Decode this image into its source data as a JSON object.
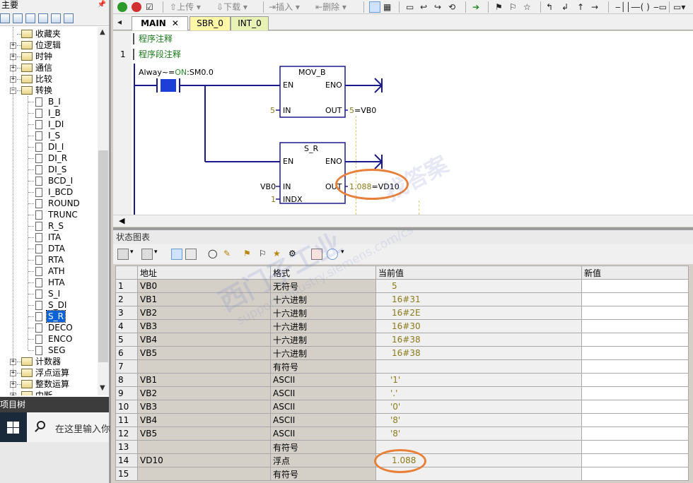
{
  "left_panel": {
    "title": "主要",
    "pin_icon": "pin-icon",
    "tree": [
      {
        "label": "收藏夹",
        "expander": "",
        "level": 1
      },
      {
        "label": "位逻辑",
        "expander": "+",
        "level": 1
      },
      {
        "label": "时钟",
        "expander": "+",
        "level": 1
      },
      {
        "label": "通信",
        "expander": "+",
        "level": 1
      },
      {
        "label": "比较",
        "expander": "+",
        "level": 1
      },
      {
        "label": "转换",
        "expander": "-",
        "level": 1
      },
      {
        "label": "B_I",
        "level": 2
      },
      {
        "label": "I_B",
        "level": 2
      },
      {
        "label": "I_DI",
        "level": 2
      },
      {
        "label": "I_S",
        "level": 2
      },
      {
        "label": "DI_I",
        "level": 2
      },
      {
        "label": "DI_R",
        "level": 2
      },
      {
        "label": "DI_S",
        "level": 2
      },
      {
        "label": "BCD_I",
        "level": 2
      },
      {
        "label": "I_BCD",
        "level": 2
      },
      {
        "label": "ROUND",
        "level": 2
      },
      {
        "label": "TRUNC",
        "level": 2
      },
      {
        "label": "R_S",
        "level": 2
      },
      {
        "label": "ITA",
        "level": 2
      },
      {
        "label": "DTA",
        "level": 2
      },
      {
        "label": "RTA",
        "level": 2
      },
      {
        "label": "ATH",
        "level": 2
      },
      {
        "label": "HTA",
        "level": 2
      },
      {
        "label": "S_I",
        "level": 2
      },
      {
        "label": "S_DI",
        "level": 2
      },
      {
        "label": "S_R",
        "level": 2,
        "selected": true
      },
      {
        "label": "DECO",
        "level": 2
      },
      {
        "label": "ENCO",
        "level": 2
      },
      {
        "label": "SEG",
        "level": 2
      },
      {
        "label": "计数器",
        "expander": "+",
        "level": 1
      },
      {
        "label": "浮点运算",
        "expander": "+",
        "level": 1
      },
      {
        "label": "整数运算",
        "expander": "+",
        "level": 1
      },
      {
        "label": "中断",
        "expander": "+",
        "level": 1
      }
    ],
    "project_tree_label": "项目树",
    "search_placeholder": "在这里输入你"
  },
  "toolbar": {
    "upload": "上传",
    "download": "下载",
    "insert": "插入",
    "delete": "删除"
  },
  "tabs": [
    {
      "label": "MAIN",
      "closable": true,
      "color": "#ffffff"
    },
    {
      "label": "SBR_0",
      "color": "#fff7a8"
    },
    {
      "label": "INT_0",
      "color": "#e8f2b5"
    }
  ],
  "editor": {
    "program_comment": "程序注释",
    "network_number": "1",
    "network_comment": "程序段注释",
    "contact": {
      "label_prefix": "Alway~=",
      "label_state": "ON",
      "label_suffix": ":SM0.0"
    },
    "mov_b": {
      "title": "MOV_B",
      "en": "EN",
      "eno": "ENO",
      "in": "IN",
      "out": "OUT",
      "in_value": "5",
      "out_value_prefix": "5",
      "out_value": "=VB0"
    },
    "s_r": {
      "title": "S_R",
      "en": "EN",
      "eno": "ENO",
      "in": "IN",
      "out": "OUT",
      "indx": "INDX",
      "in_value": "VB0",
      "indx_value": "1",
      "out_value_prefix": "1.088",
      "out_value": "=VD10"
    }
  },
  "status_chart": {
    "title": "状态图表",
    "columns": [
      "",
      "地址",
      "格式",
      "当前值",
      "新值"
    ],
    "rows": [
      {
        "n": "1",
        "addr": "VB0",
        "fmt": "无符号",
        "val": "5",
        "new": ""
      },
      {
        "n": "2",
        "addr": "VB1",
        "fmt": "十六进制",
        "val": "16#31",
        "new": ""
      },
      {
        "n": "3",
        "addr": "VB2",
        "fmt": "十六进制",
        "val": "16#2E",
        "new": ""
      },
      {
        "n": "4",
        "addr": "VB3",
        "fmt": "十六进制",
        "val": "16#30",
        "new": ""
      },
      {
        "n": "5",
        "addr": "VB4",
        "fmt": "十六进制",
        "val": "16#38",
        "new": ""
      },
      {
        "n": "6",
        "addr": "VB5",
        "fmt": "十六进制",
        "val": "16#38",
        "new": ""
      },
      {
        "n": "7",
        "addr": "",
        "fmt": "有符号",
        "val": "",
        "new": ""
      },
      {
        "n": "8",
        "addr": "VB1",
        "fmt": "ASCII",
        "val": "'1'",
        "new": ""
      },
      {
        "n": "9",
        "addr": "VB2",
        "fmt": "ASCII",
        "val": "'.'",
        "new": ""
      },
      {
        "n": "10",
        "addr": "VB3",
        "fmt": "ASCII",
        "val": "'0'",
        "new": ""
      },
      {
        "n": "11",
        "addr": "VB4",
        "fmt": "ASCII",
        "val": "'8'",
        "new": ""
      },
      {
        "n": "12",
        "addr": "VB5",
        "fmt": "ASCII",
        "val": "'8'",
        "new": ""
      },
      {
        "n": "13",
        "addr": "",
        "fmt": "有符号",
        "val": "",
        "new": ""
      },
      {
        "n": "14",
        "addr": "VD10",
        "fmt": "浮点",
        "val": "1.088",
        "new": ""
      },
      {
        "n": "15",
        "addr": "",
        "fmt": "有符号",
        "val": "",
        "new": ""
      }
    ]
  },
  "watermark": {
    "cn": "西门子工业",
    "cn2": "找答案",
    "url": "support.industry.siemens.com/cs"
  },
  "colors": {
    "accent_orange": "#e8803a",
    "value_text": "#8a7a18",
    "comment_green": "#1a7a1a",
    "wire_blue": "#1a1a8c"
  }
}
